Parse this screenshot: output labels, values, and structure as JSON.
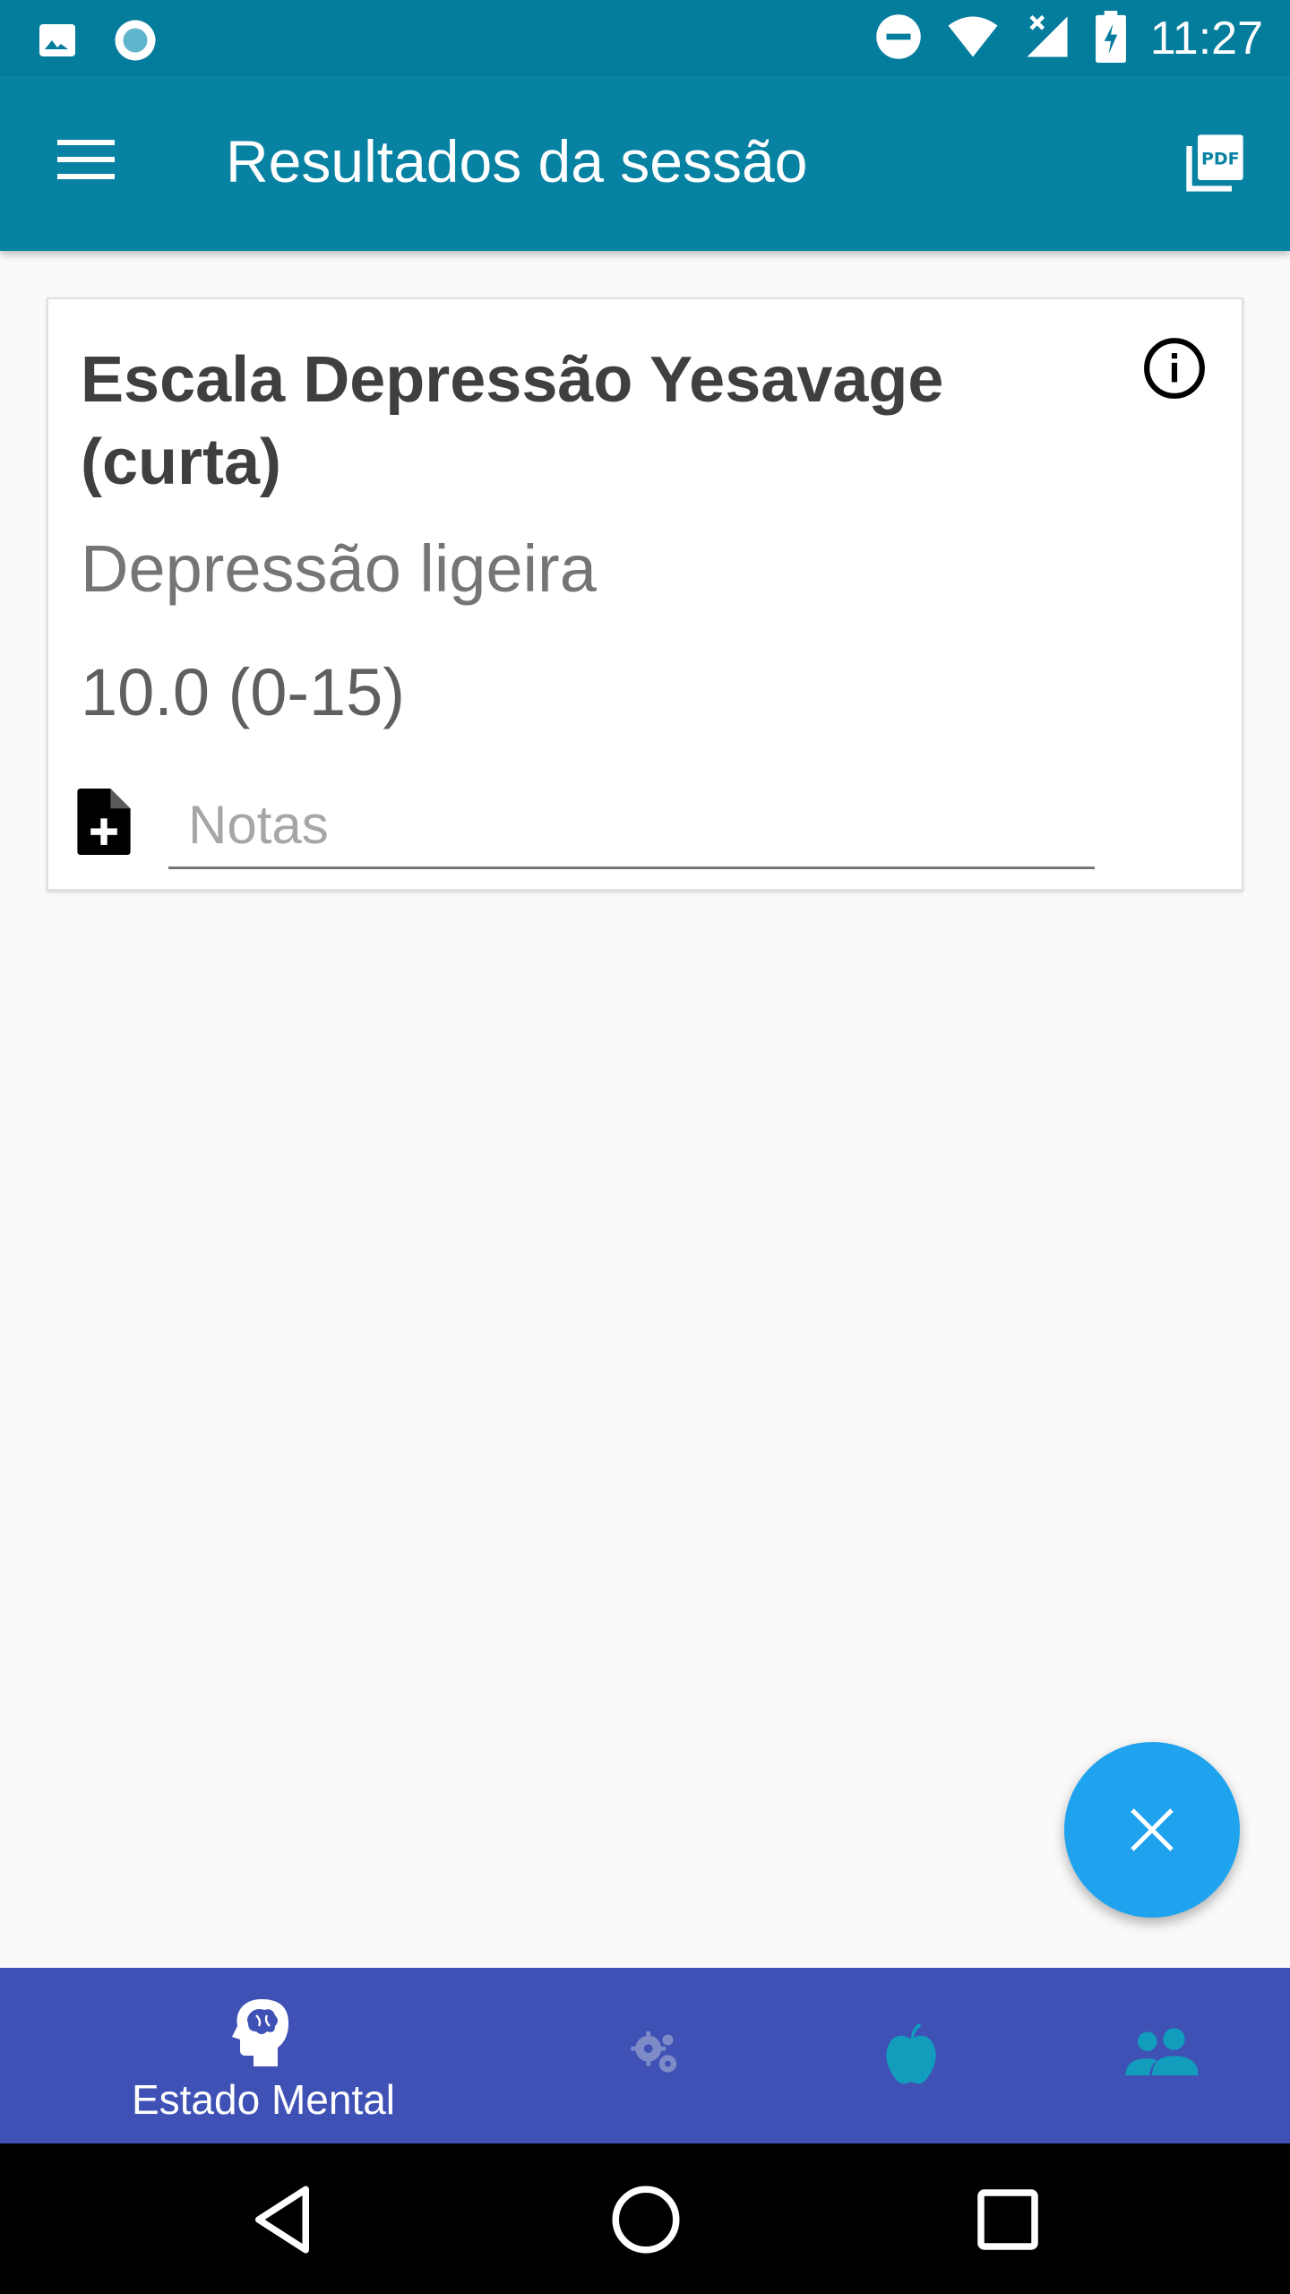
{
  "status_bar": {
    "time": "11:27",
    "icons": [
      "image-icon",
      "record-icon",
      "do-not-disturb-icon",
      "wifi-icon",
      "signal-icon",
      "battery-charging-icon"
    ]
  },
  "app_bar": {
    "title": "Resultados da sessão",
    "menu_icon": "menu-icon",
    "pdf_icon": "pdf-icon",
    "pdf_icon_text": "PDF"
  },
  "card": {
    "title": "Escala Depressão Yesavage (curta)",
    "result": "Depressão ligeira",
    "score": "10.0 (0-15)",
    "notes_placeholder": "Notas",
    "notes_value": "",
    "info_icon": "info-icon",
    "note_icon": "note-add-icon"
  },
  "fab": {
    "icon": "close-icon"
  },
  "bottom_nav": {
    "items": [
      {
        "label": "Estado Mental",
        "icon": "brain-head-icon",
        "active": true
      },
      {
        "label": "",
        "icon": "gears-icon",
        "active": false
      },
      {
        "label": "",
        "icon": "apple-icon",
        "active": false
      },
      {
        "label": "",
        "icon": "people-icon",
        "active": false
      }
    ]
  },
  "system_nav": {
    "items": [
      "back-icon",
      "home-icon",
      "recents-icon"
    ]
  },
  "colors": {
    "status_bar": "#047c9c",
    "app_bar": "#0782a2",
    "fab": "#1fa3ef",
    "bottom_nav": "#3f51b5",
    "nav_inactive_gears": "#7d8bc6",
    "nav_inactive_teal": "#129dbd"
  }
}
